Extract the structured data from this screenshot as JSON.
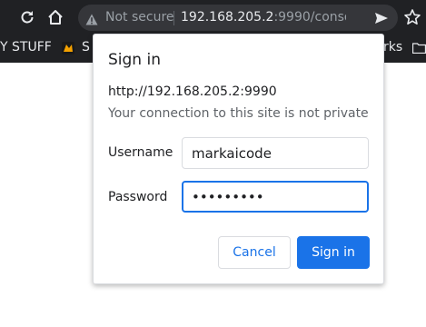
{
  "browser": {
    "not_secure_label": "Not secure",
    "url_host": "192.168.205.2",
    "url_rest": ":9990/console/in...",
    "icons": [
      "reload-icon",
      "home-icon",
      "warning-icon",
      "send-icon",
      "star-icon"
    ]
  },
  "bookmarks": {
    "left_label": "Y STUFF",
    "item_label": "S",
    "right_label": "rks"
  },
  "dialog": {
    "title": "Sign in",
    "origin": "http://192.168.205.2:9990",
    "warning": "Your connection to this site is not private",
    "username_label": "Username",
    "username_value": "markaicode",
    "password_label": "Password",
    "password_value": "•••••••••",
    "cancel_label": "Cancel",
    "signin_label": "Sign in"
  },
  "colors": {
    "accent": "#1a73e8",
    "toolbar_bg": "#202124",
    "omnibox_bg": "#35363a"
  }
}
